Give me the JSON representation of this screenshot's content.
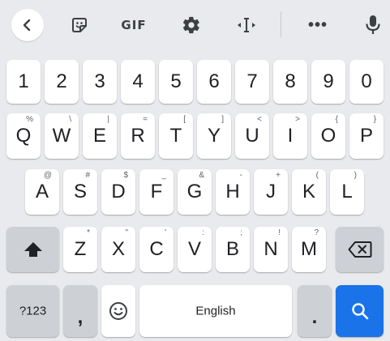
{
  "toolbar": {
    "gif_label": "GIF",
    "more_label": "•••"
  },
  "rows": {
    "numbers": [
      "1",
      "2",
      "3",
      "4",
      "5",
      "6",
      "7",
      "8",
      "9",
      "0"
    ],
    "row1": [
      {
        "key": "Q",
        "hint": "%"
      },
      {
        "key": "W",
        "hint": "\\"
      },
      {
        "key": "E",
        "hint": "|"
      },
      {
        "key": "R",
        "hint": "="
      },
      {
        "key": "T",
        "hint": "["
      },
      {
        "key": "Y",
        "hint": "]"
      },
      {
        "key": "U",
        "hint": "<"
      },
      {
        "key": "I",
        "hint": ">"
      },
      {
        "key": "O",
        "hint": "{"
      },
      {
        "key": "P",
        "hint": "}"
      }
    ],
    "row2": [
      {
        "key": "A",
        "hint": "@"
      },
      {
        "key": "S",
        "hint": "#"
      },
      {
        "key": "D",
        "hint": "$"
      },
      {
        "key": "F",
        "hint": "_"
      },
      {
        "key": "G",
        "hint": "&"
      },
      {
        "key": "H",
        "hint": "-"
      },
      {
        "key": "J",
        "hint": "+"
      },
      {
        "key": "K",
        "hint": "("
      },
      {
        "key": "L",
        "hint": ")"
      }
    ],
    "row3": [
      {
        "key": "Z",
        "hint": "*"
      },
      {
        "key": "X",
        "hint": "\""
      },
      {
        "key": "C",
        "hint": "'"
      },
      {
        "key": "V",
        "hint": ":"
      },
      {
        "key": "B",
        "hint": ";"
      },
      {
        "key": "N",
        "hint": "!"
      },
      {
        "key": "M",
        "hint": "?"
      }
    ]
  },
  "bottom": {
    "symbols_label": "?123",
    "comma_label": ",",
    "space_label": "English",
    "period_label": "."
  },
  "colors": {
    "background": "#e8eaed",
    "key": "#ffffff",
    "function_key": "#cdd0d5",
    "accent": "#1a73e8"
  },
  "icons": {
    "back": "chevron-left-icon",
    "sticker": "sticker-icon",
    "settings": "gear-icon",
    "cursor": "text-cursor-icon",
    "more": "more-icon",
    "voice": "microphone-icon",
    "shift": "shift-icon",
    "backspace": "backspace-icon",
    "emoji": "emoji-icon",
    "search": "search-icon"
  }
}
